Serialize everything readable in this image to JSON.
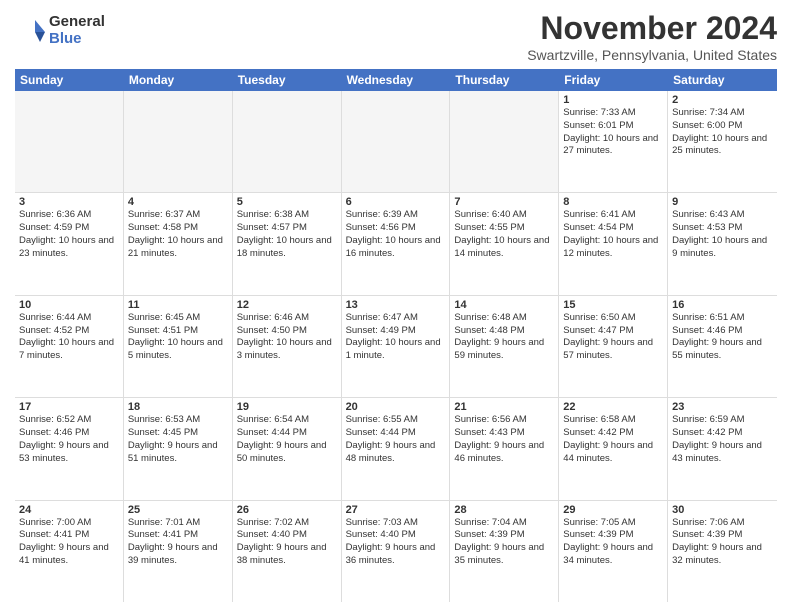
{
  "logo": {
    "general": "General",
    "blue": "Blue"
  },
  "title": "November 2024",
  "location": "Swartzville, Pennsylvania, United States",
  "header_days": [
    "Sunday",
    "Monday",
    "Tuesday",
    "Wednesday",
    "Thursday",
    "Friday",
    "Saturday"
  ],
  "rows": [
    [
      {
        "day": "",
        "info": "",
        "empty": true
      },
      {
        "day": "",
        "info": "",
        "empty": true
      },
      {
        "day": "",
        "info": "",
        "empty": true
      },
      {
        "day": "",
        "info": "",
        "empty": true
      },
      {
        "day": "",
        "info": "",
        "empty": true
      },
      {
        "day": "1",
        "info": "Sunrise: 7:33 AM\nSunset: 6:01 PM\nDaylight: 10 hours and 27 minutes."
      },
      {
        "day": "2",
        "info": "Sunrise: 7:34 AM\nSunset: 6:00 PM\nDaylight: 10 hours and 25 minutes."
      }
    ],
    [
      {
        "day": "3",
        "info": "Sunrise: 6:36 AM\nSunset: 4:59 PM\nDaylight: 10 hours and 23 minutes."
      },
      {
        "day": "4",
        "info": "Sunrise: 6:37 AM\nSunset: 4:58 PM\nDaylight: 10 hours and 21 minutes."
      },
      {
        "day": "5",
        "info": "Sunrise: 6:38 AM\nSunset: 4:57 PM\nDaylight: 10 hours and 18 minutes."
      },
      {
        "day": "6",
        "info": "Sunrise: 6:39 AM\nSunset: 4:56 PM\nDaylight: 10 hours and 16 minutes."
      },
      {
        "day": "7",
        "info": "Sunrise: 6:40 AM\nSunset: 4:55 PM\nDaylight: 10 hours and 14 minutes."
      },
      {
        "day": "8",
        "info": "Sunrise: 6:41 AM\nSunset: 4:54 PM\nDaylight: 10 hours and 12 minutes."
      },
      {
        "day": "9",
        "info": "Sunrise: 6:43 AM\nSunset: 4:53 PM\nDaylight: 10 hours and 9 minutes."
      }
    ],
    [
      {
        "day": "10",
        "info": "Sunrise: 6:44 AM\nSunset: 4:52 PM\nDaylight: 10 hours and 7 minutes."
      },
      {
        "day": "11",
        "info": "Sunrise: 6:45 AM\nSunset: 4:51 PM\nDaylight: 10 hours and 5 minutes."
      },
      {
        "day": "12",
        "info": "Sunrise: 6:46 AM\nSunset: 4:50 PM\nDaylight: 10 hours and 3 minutes."
      },
      {
        "day": "13",
        "info": "Sunrise: 6:47 AM\nSunset: 4:49 PM\nDaylight: 10 hours and 1 minute."
      },
      {
        "day": "14",
        "info": "Sunrise: 6:48 AM\nSunset: 4:48 PM\nDaylight: 9 hours and 59 minutes."
      },
      {
        "day": "15",
        "info": "Sunrise: 6:50 AM\nSunset: 4:47 PM\nDaylight: 9 hours and 57 minutes."
      },
      {
        "day": "16",
        "info": "Sunrise: 6:51 AM\nSunset: 4:46 PM\nDaylight: 9 hours and 55 minutes."
      }
    ],
    [
      {
        "day": "17",
        "info": "Sunrise: 6:52 AM\nSunset: 4:46 PM\nDaylight: 9 hours and 53 minutes."
      },
      {
        "day": "18",
        "info": "Sunrise: 6:53 AM\nSunset: 4:45 PM\nDaylight: 9 hours and 51 minutes."
      },
      {
        "day": "19",
        "info": "Sunrise: 6:54 AM\nSunset: 4:44 PM\nDaylight: 9 hours and 50 minutes."
      },
      {
        "day": "20",
        "info": "Sunrise: 6:55 AM\nSunset: 4:44 PM\nDaylight: 9 hours and 48 minutes."
      },
      {
        "day": "21",
        "info": "Sunrise: 6:56 AM\nSunset: 4:43 PM\nDaylight: 9 hours and 46 minutes."
      },
      {
        "day": "22",
        "info": "Sunrise: 6:58 AM\nSunset: 4:42 PM\nDaylight: 9 hours and 44 minutes."
      },
      {
        "day": "23",
        "info": "Sunrise: 6:59 AM\nSunset: 4:42 PM\nDaylight: 9 hours and 43 minutes."
      }
    ],
    [
      {
        "day": "24",
        "info": "Sunrise: 7:00 AM\nSunset: 4:41 PM\nDaylight: 9 hours and 41 minutes."
      },
      {
        "day": "25",
        "info": "Sunrise: 7:01 AM\nSunset: 4:41 PM\nDaylight: 9 hours and 39 minutes."
      },
      {
        "day": "26",
        "info": "Sunrise: 7:02 AM\nSunset: 4:40 PM\nDaylight: 9 hours and 38 minutes."
      },
      {
        "day": "27",
        "info": "Sunrise: 7:03 AM\nSunset: 4:40 PM\nDaylight: 9 hours and 36 minutes."
      },
      {
        "day": "28",
        "info": "Sunrise: 7:04 AM\nSunset: 4:39 PM\nDaylight: 9 hours and 35 minutes."
      },
      {
        "day": "29",
        "info": "Sunrise: 7:05 AM\nSunset: 4:39 PM\nDaylight: 9 hours and 34 minutes."
      },
      {
        "day": "30",
        "info": "Sunrise: 7:06 AM\nSunset: 4:39 PM\nDaylight: 9 hours and 32 minutes."
      }
    ]
  ]
}
